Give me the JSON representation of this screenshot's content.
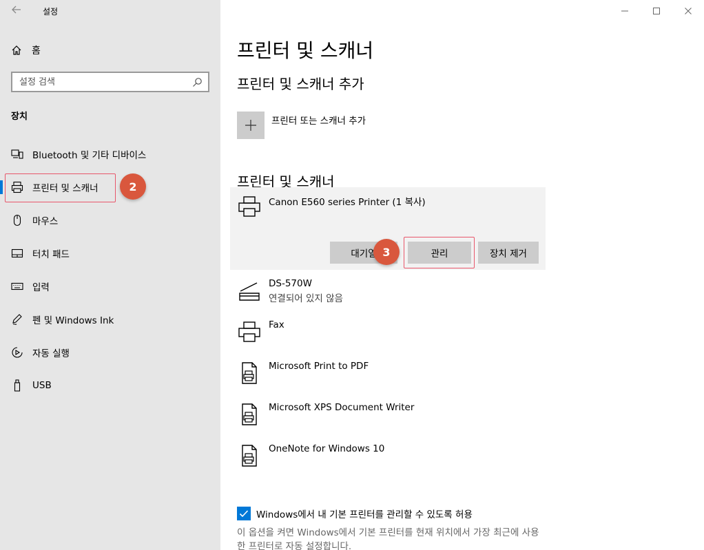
{
  "window": {
    "title": "설정",
    "controls": [
      "minimize",
      "maximize",
      "close"
    ]
  },
  "sidebar": {
    "home_label": "홈",
    "search_placeholder": "설정 검색",
    "section_title": "장치",
    "items": [
      {
        "label": "Bluetooth 및 기타 디바이스",
        "icon": "bluetooth-devices-icon"
      },
      {
        "label": "프린터 및 스캐너",
        "icon": "printer-icon",
        "active": true
      },
      {
        "label": "마우스",
        "icon": "mouse-icon"
      },
      {
        "label": "터치 패드",
        "icon": "touchpad-icon"
      },
      {
        "label": "입력",
        "icon": "keyboard-icon"
      },
      {
        "label": "펜 및 Windows Ink",
        "icon": "pen-icon"
      },
      {
        "label": "자동 실행",
        "icon": "autoplay-icon"
      },
      {
        "label": "USB",
        "icon": "usb-icon"
      }
    ]
  },
  "badges": {
    "step2": "2",
    "step3": "3"
  },
  "main": {
    "title": "프린터 및 스캐너",
    "add_section_title": "프린터 및 스캐너 추가",
    "add_button_label": "프린터 또는 스캐너 추가",
    "list_section_title": "프린터 및 스캐너",
    "selected_printer": {
      "name": "Canon E560 series Printer (1 복사)",
      "buttons": {
        "queue": "대기열",
        "manage": "관리",
        "remove": "장치 제거"
      }
    },
    "devices": [
      {
        "name": "DS-570W",
        "status": "연결되어 있지 않음",
        "icon": "scanner-icon"
      },
      {
        "name": "Fax",
        "status": "",
        "icon": "printer-icon"
      },
      {
        "name": "Microsoft Print to PDF",
        "status": "",
        "icon": "virtual-printer-icon"
      },
      {
        "name": "Microsoft XPS Document Writer",
        "status": "",
        "icon": "virtual-printer-icon"
      },
      {
        "name": "OneNote for Windows 10",
        "status": "",
        "icon": "virtual-printer-icon"
      }
    ],
    "default_printer_checkbox": {
      "label": "Windows에서 내 기본 프린터를 관리할 수 있도록 허용",
      "checked": true
    },
    "description": "이 옵션을 켜면 Windows에서 기본 프린터를 현재 위치에서 가장 최근에 사용한 프린터로 자동 설정합니다."
  },
  "colors": {
    "sidebar_bg": "#e6e6e6",
    "accent": "#0078d7",
    "highlight_border": "#e8566a",
    "badge_bg": "#d9573d"
  }
}
